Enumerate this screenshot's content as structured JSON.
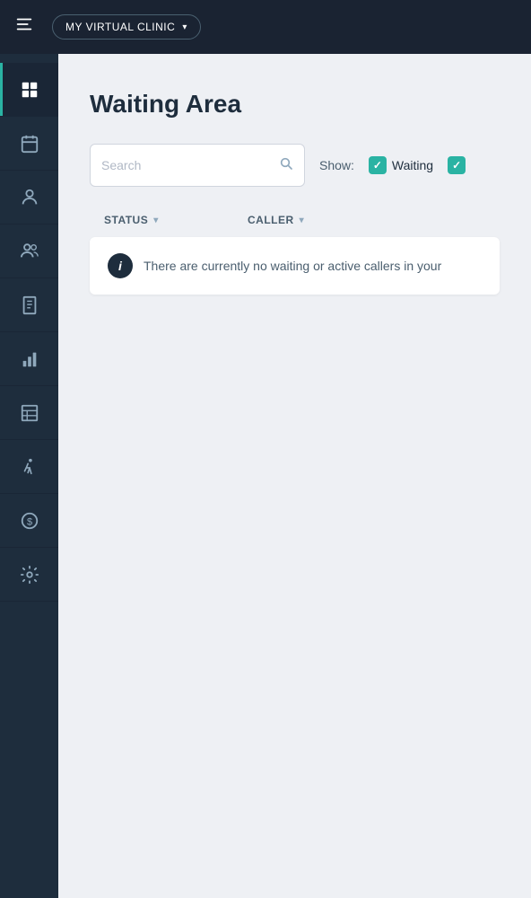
{
  "topbar": {
    "menu_icon": "☰",
    "clinic_name": "MY VIRTUAL CLINIC",
    "clinic_chevron": "▾"
  },
  "sidebar": {
    "items": [
      {
        "id": "dashboard",
        "icon": "grid",
        "active": true
      },
      {
        "id": "calendar",
        "icon": "calendar",
        "active": false
      },
      {
        "id": "patient",
        "icon": "person",
        "active": false
      },
      {
        "id": "team",
        "icon": "people",
        "active": false
      },
      {
        "id": "records",
        "icon": "bookmark",
        "active": false
      },
      {
        "id": "reports",
        "icon": "bar-chart",
        "active": false
      },
      {
        "id": "forms",
        "icon": "table",
        "active": false
      },
      {
        "id": "workflow",
        "icon": "person-walking",
        "active": false
      },
      {
        "id": "billing",
        "icon": "dollar-circle",
        "active": false
      },
      {
        "id": "settings",
        "icon": "gear",
        "active": false
      }
    ]
  },
  "page": {
    "title": "Waiting Area",
    "search_placeholder": "Search",
    "show_label": "Show:",
    "filter_waiting": "Waiting",
    "table": {
      "col_status": "STATUS",
      "col_caller": "CALLER",
      "empty_message": "There are currently no waiting or active callers in your"
    }
  }
}
